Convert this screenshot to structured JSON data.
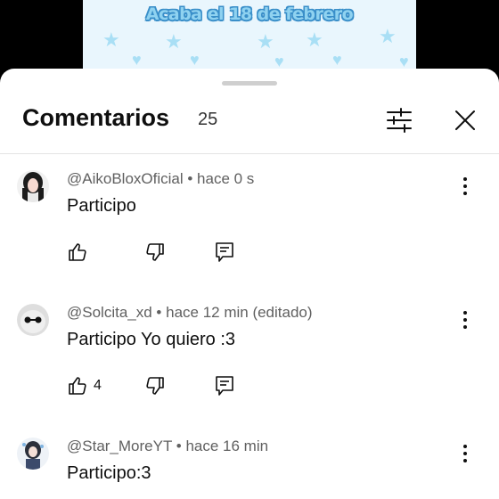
{
  "banner": {
    "text": "Acaba el 18 de febrero"
  },
  "sheet": {
    "title": "Comentarios",
    "count": "25"
  },
  "colors": {
    "accent": "#3ea6ff",
    "muted": "#606060"
  },
  "icons": [
    "filter-icon",
    "close-icon",
    "like-icon",
    "dislike-icon",
    "reply-icon",
    "more-vert-icon"
  ],
  "comments": [
    {
      "author": "@AikoBloxOficial",
      "time": "hace 0 s",
      "text": "Participo",
      "likes": ""
    },
    {
      "author": "@Solcita_xd",
      "time": "hace 12 min (editado)",
      "text": "Participo Yo quiero :3",
      "likes": "4"
    },
    {
      "author": "@Star_MoreYT",
      "time": "hace 16 min",
      "text": "Participo:3",
      "likes": ""
    }
  ]
}
